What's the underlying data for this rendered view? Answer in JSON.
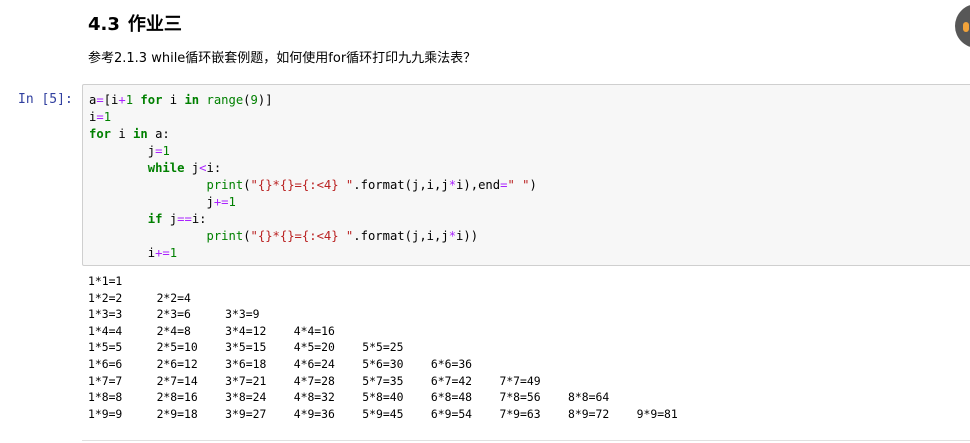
{
  "section": {
    "number": "4.3",
    "title": "作业三",
    "description": "参考2.1.3 while循环嵌套例题，如何使用for循环打印九九乘法表？"
  },
  "cell": {
    "prompt": "In [5]:",
    "code_lines": [
      "a=[i+1 for i in range(9)]",
      "i=1",
      "for i in a:",
      "        j=1",
      "        while j<i:",
      "                print(\"{}*{}={:<4} \".format(j,i,j*i),end=\" \")",
      "                j+=1",
      "        if j==i:",
      "                print(\"{}*{}={:<4} \".format(j,i,j*i))",
      "        i+=1"
    ]
  },
  "output": {
    "lines": [
      "1*1=1",
      "1*2=2     2*2=4",
      "1*3=3     2*3=6     3*3=9",
      "1*4=4     2*4=8     3*4=12    4*4=16",
      "1*5=5     2*5=10    3*5=15    4*5=20    5*5=25",
      "1*6=6     2*6=12    3*6=18    4*6=24    5*6=30    6*6=36",
      "1*7=7     2*7=14    3*7=21    4*7=28    5*7=35    6*7=42    7*7=49",
      "1*8=8     2*8=16    3*8=24    4*8=32    5*8=40    6*8=48    7*8=56    8*8=64",
      "1*9=9     2*9=18    3*9=27    4*9=36    5*9=45    6*9=54    7*9=63    8*9=72    9*9=81"
    ]
  },
  "colors": {
    "keyword": "#008000",
    "string": "#ba2121",
    "operator": "#aa22ff",
    "prompt": "#303f9f",
    "input_bg": "#f7f7f7",
    "input_border": "#cfcfcf"
  },
  "icons": {
    "avatar": "user-avatar-icon"
  }
}
